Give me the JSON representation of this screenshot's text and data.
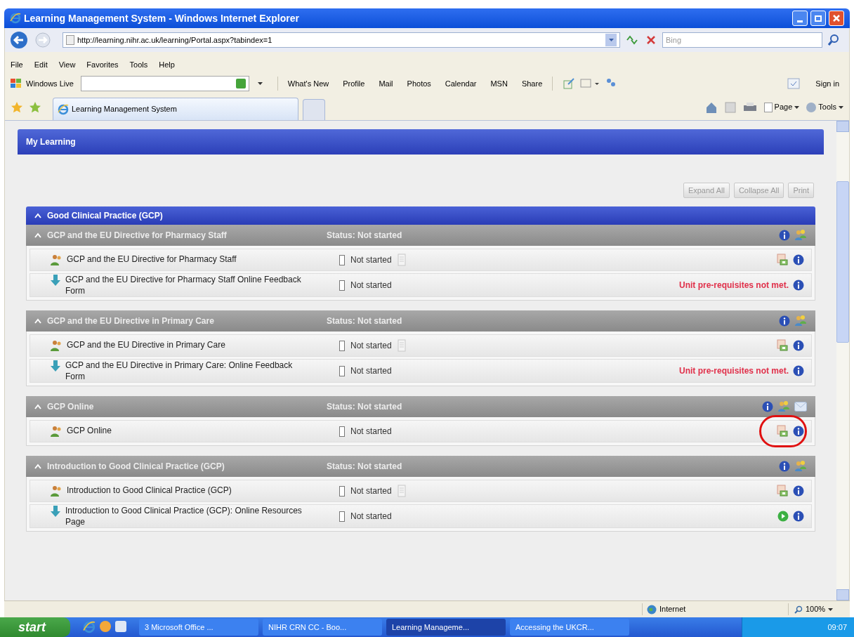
{
  "window": {
    "title": "Learning Management System - Windows Internet Explorer"
  },
  "address_bar": {
    "url": "http://learning.nihr.ac.uk/learning/Portal.aspx?tabindex=1",
    "search_placeholder": "Bing"
  },
  "menu": [
    "File",
    "Edit",
    "View",
    "Favorites",
    "Tools",
    "Help"
  ],
  "live_toolbar": {
    "brand": "Windows Live",
    "links": [
      "What's New",
      "Profile",
      "Mail",
      "Photos",
      "Calendar",
      "MSN",
      "Share"
    ],
    "sign_in": "Sign in"
  },
  "tabs": [
    {
      "label": "Learning Management System",
      "selected": true
    }
  ],
  "command_bar": [
    "Page",
    "Tools"
  ],
  "page": {
    "title": "My Learning",
    "buttons": [
      "Expand All",
      "Collapse All",
      "Print"
    ],
    "group": {
      "title": "Good Clinical Practice (GCP)",
      "expanded": true,
      "sections": [
        {
          "title": "GCP and the EU Directive for Pharmacy Staff",
          "status": "Status: Not started",
          "expanded": true,
          "mail": false,
          "items": [
            {
              "kind": "course",
              "title": "GCP and the EU Directive for Pharmacy Staff",
              "status": "Not started",
              "action": {
                "kind": "launch"
              },
              "highlight": false
            },
            {
              "kind": "form",
              "title": "GCP and the EU Directive for Pharmacy Staff Online Feedback Form",
              "status": "Not started",
              "action": {
                "kind": "blocked",
                "message": "Unit pre-requisites not met."
              },
              "highlight": false
            }
          ]
        },
        {
          "title": "GCP and the EU Directive in Primary Care",
          "status": "Status: Not started",
          "expanded": true,
          "mail": false,
          "items": [
            {
              "kind": "course",
              "title": "GCP and the EU Directive in Primary Care",
              "status": "Not started",
              "action": {
                "kind": "launch"
              },
              "highlight": false
            },
            {
              "kind": "form",
              "title": "GCP and the EU Directive in Primary Care: Online Feedback Form",
              "status": "Not started",
              "action": {
                "kind": "blocked",
                "message": "Unit pre-requisites not met."
              },
              "highlight": false
            }
          ]
        },
        {
          "title": "GCP Online",
          "status": "Status: Not started",
          "expanded": true,
          "mail": true,
          "items": [
            {
              "kind": "online",
              "title": "GCP Online",
              "status": "Not started",
              "action": {
                "kind": "launch"
              },
              "highlight": true
            }
          ]
        },
        {
          "title": "Introduction to Good Clinical Practice (GCP)",
          "status": "Status: Not started",
          "expanded": true,
          "mail": false,
          "items": [
            {
              "kind": "course",
              "title": "Introduction to Good Clinical Practice (GCP)",
              "status": "Not started",
              "action": {
                "kind": "launch"
              },
              "highlight": false
            },
            {
              "kind": "form",
              "title": "Introduction to Good Clinical Practice (GCP): Online Resources Page",
              "status": "Not started",
              "action": {
                "kind": "play"
              },
              "highlight": false
            }
          ]
        }
      ]
    }
  },
  "status_bar": {
    "zone": "Internet",
    "zoom": "100%"
  },
  "taskbar": {
    "start": "start",
    "tasks": [
      {
        "label": "3 Microsoft Office ...",
        "selected": false
      },
      {
        "label": "NIHR CRN CC - Boo...",
        "selected": false
      },
      {
        "label": "Learning Manageme...",
        "selected": true
      },
      {
        "label": "Accessing the UKCR...",
        "selected": false
      }
    ],
    "clock": "09:07"
  }
}
